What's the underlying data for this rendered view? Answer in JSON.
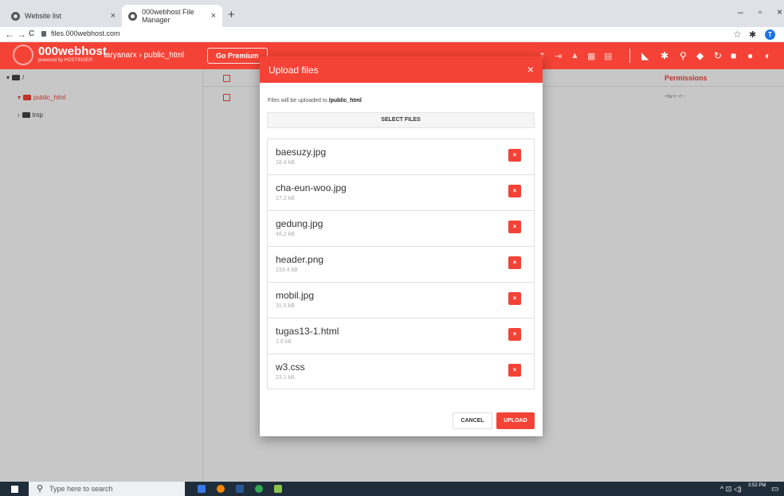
{
  "browser": {
    "tabs": [
      {
        "title": "Website list",
        "close": "×"
      },
      {
        "title": "000webhost File Manager",
        "close": "×"
      }
    ],
    "new_tab": "+",
    "window_controls": {
      "minimize": "–",
      "maximize": "▫",
      "close": "×"
    },
    "nav": {
      "back": "←",
      "forward": "→",
      "reload": "C"
    },
    "url": "files.000webhost.com",
    "star": "☆",
    "extensions": "✱",
    "profile_initial": "T"
  },
  "app": {
    "brand": "000webhost",
    "brand_sub": "powered by HOSTINGER",
    "breadcrumb": "taryanarx  ›  public_html",
    "go_premium": "Go Premium",
    "toolbar_icons": [
      "upload-icon",
      "export-icon",
      "lock-icon",
      "archive-icon",
      "delete-icon",
      "select-icon",
      "settings-icon",
      "search-icon",
      "cloud-icon",
      "refresh-icon",
      "grid-icon",
      "help-icon",
      "power-icon"
    ],
    "toolbar_glyphs": [
      "⇡",
      "⇥",
      "▲",
      "▦",
      "▤",
      "◣",
      "✱",
      "⚲",
      "◆",
      "↻",
      "■",
      "●",
      "◐"
    ],
    "colors": {
      "accent": "#f44336"
    }
  },
  "sidebar": {
    "root": "/",
    "items": [
      {
        "label": "public_html",
        "active": true
      },
      {
        "label": "tmp",
        "active": false
      }
    ]
  },
  "main": {
    "column_permissions": "Permissions",
    "row_permission": "-rw-r--r--"
  },
  "modal": {
    "title": "Upload files",
    "close": "×",
    "upload_to_prefix": "Files will be uploaded to ",
    "upload_to_path": "/public_html",
    "select_files": "SELECT FILES",
    "files": [
      {
        "name": "baesuzy.jpg",
        "size": "18.4 kB"
      },
      {
        "name": "cha-eun-woo.jpg",
        "size": "17.2 kB"
      },
      {
        "name": "gedung.jpg",
        "size": "48.2 kB"
      },
      {
        "name": "header.png",
        "size": "233.4 kB"
      },
      {
        "name": "mobil.jpg",
        "size": "31.5 kB"
      },
      {
        "name": "tugas13-1.html",
        "size": "1.6 kB"
      },
      {
        "name": "w3.css",
        "size": "23.1 kB"
      }
    ],
    "remove_glyph": "×",
    "cancel": "CANCEL",
    "upload": "UPLOAD"
  },
  "taskbar": {
    "search_placeholder": "Type here to search",
    "time": "3:52 PM",
    "tray": "^ ⊡ ◁)"
  }
}
